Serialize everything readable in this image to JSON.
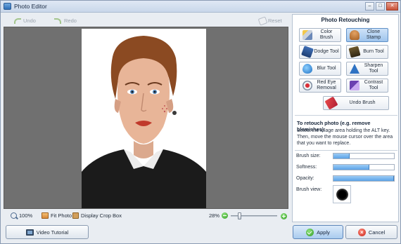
{
  "window": {
    "title": "Photo Editor",
    "minimize": "–",
    "maximize": "□",
    "close": "✕"
  },
  "toolbar": {
    "undo": "Undo",
    "redo": "Redo",
    "reset": "Reset"
  },
  "bottom": {
    "zoom": "100%",
    "fit_photo": "Fit Photo",
    "display_crop_box": "Display Crop Box",
    "zoom_percent": "28%",
    "zoom_slider_value": 0.2
  },
  "video_tutorial": "Video Tutorial",
  "panel": {
    "title": "Photo Retouching",
    "tools": [
      {
        "label": "Color Brush",
        "icon": "color-brush-icon",
        "active": false
      },
      {
        "label": "Clone Stamp",
        "icon": "clone-stamp-icon",
        "active": true
      },
      {
        "label": "Dodge Tool",
        "icon": "dodge-tool-icon",
        "active": false
      },
      {
        "label": "Burn Tool",
        "icon": "burn-tool-icon",
        "active": false
      },
      {
        "label": "Blur Tool",
        "icon": "blur-tool-icon",
        "active": false
      },
      {
        "label": "Sharpen Tool",
        "icon": "sharpen-tool-icon",
        "active": false
      },
      {
        "label": "Red Eye Removal",
        "icon": "red-eye-icon",
        "active": false
      },
      {
        "label": "Contrast Tool",
        "icon": "contrast-tool-icon",
        "active": false
      }
    ],
    "undo_brush": "Undo Brush",
    "hint_title": "To retouch photo (e.g. remove blemishes):",
    "hint_text": "Select the image area holding the ALT key. Then, move the mouse cursor over the area that you want to replace.",
    "sliders": [
      {
        "label": "Brush size:",
        "value": 0.27
      },
      {
        "label": "Softness:",
        "value": 0.59
      },
      {
        "label": "Opacity:",
        "value": 1.0
      }
    ],
    "brush_view": "Brush view:"
  },
  "buttons": {
    "apply": "Apply",
    "cancel": "Cancel"
  },
  "colors": {
    "accent": "#5ba2e6",
    "canvas_bg": "#707070",
    "ok_green": "#2f9a21",
    "cancel_red": "#c8241a"
  }
}
